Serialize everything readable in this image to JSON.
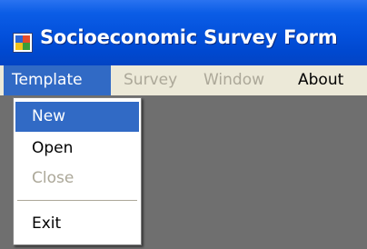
{
  "window": {
    "title": "Socioeconomic Survey Form",
    "icon": "application-icon"
  },
  "menubar": {
    "items": [
      {
        "label": "Template",
        "state": "active"
      },
      {
        "label": "Survey",
        "state": "disabled"
      },
      {
        "label": "Window",
        "state": "disabled"
      },
      {
        "label": "About",
        "state": "enabled"
      }
    ]
  },
  "template_menu": {
    "items": [
      {
        "label": "New",
        "state": "selected"
      },
      {
        "label": "Open",
        "state": "enabled"
      },
      {
        "label": "Close",
        "state": "disabled"
      },
      {
        "label": "Exit",
        "state": "enabled"
      }
    ]
  },
  "colors": {
    "titlebar": "#0350db",
    "menubar": "#ece9d8",
    "highlight": "#316ac5",
    "disabled_text": "#aca899",
    "workspace": "#6f6f6f"
  }
}
